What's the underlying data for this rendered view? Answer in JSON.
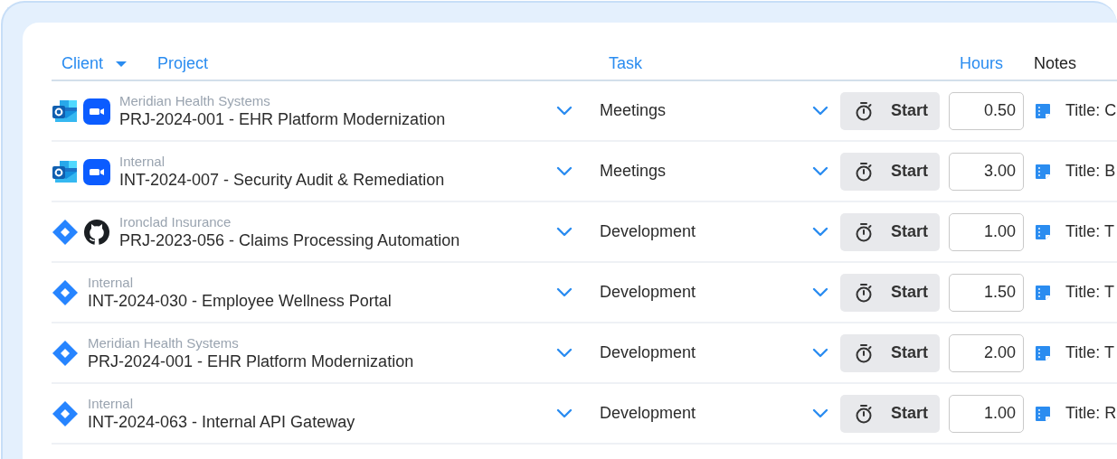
{
  "table": {
    "columns": [
      {
        "label": "Client",
        "sortable": true,
        "sorted_descending": true
      },
      {
        "label": "Project",
        "sortable": true
      },
      {
        "label": "Task",
        "sortable": true
      },
      {
        "label": "Hours",
        "sortable": true
      },
      {
        "label": "Notes",
        "sortable": false
      }
    ],
    "rows": [
      {
        "integrations": [
          {
            "kind": "outlook"
          },
          {
            "kind": "zoom"
          }
        ],
        "client": "Meridian Health Systems",
        "project": "PRJ-2024-001 - EHR Platform Modernization",
        "task": "Meetings",
        "timer": "Start",
        "hours": "0.50",
        "notes": "Title: C"
      },
      {
        "integrations": [
          {
            "kind": "outlook"
          },
          {
            "kind": "zoom"
          }
        ],
        "client": "Internal",
        "project": "INT-2024-007 - Security Audit & Remediation",
        "task": "Meetings",
        "timer": "Start",
        "hours": "3.00",
        "notes": "Title: B"
      },
      {
        "integrations": [
          {
            "kind": "jira"
          },
          {
            "kind": "github"
          }
        ],
        "client": "Ironclad Insurance",
        "project": "PRJ-2023-056 - Claims Processing Automation",
        "task": "Development",
        "timer": "Start",
        "hours": "1.00",
        "notes": "Title: T"
      },
      {
        "integrations": [
          {
            "kind": "jira"
          }
        ],
        "client": "Internal",
        "project": "INT-2024-030 - Employee Wellness Portal",
        "task": "Development",
        "timer": "Start",
        "hours": "1.50",
        "notes": "Title: T"
      },
      {
        "integrations": [
          {
            "kind": "jira"
          }
        ],
        "client": "Meridian Health Systems",
        "project": "PRJ-2024-001 - EHR Platform Modernization",
        "task": "Development",
        "timer": "Start",
        "hours": "2.00",
        "notes": "Title: T"
      },
      {
        "integrations": [
          {
            "kind": "jira"
          }
        ],
        "client": "Internal",
        "project": "INT-2024-063 - Internal API Gateway",
        "task": "Development",
        "timer": "Start",
        "hours": "1.00",
        "notes": "Title: R"
      }
    ]
  }
}
